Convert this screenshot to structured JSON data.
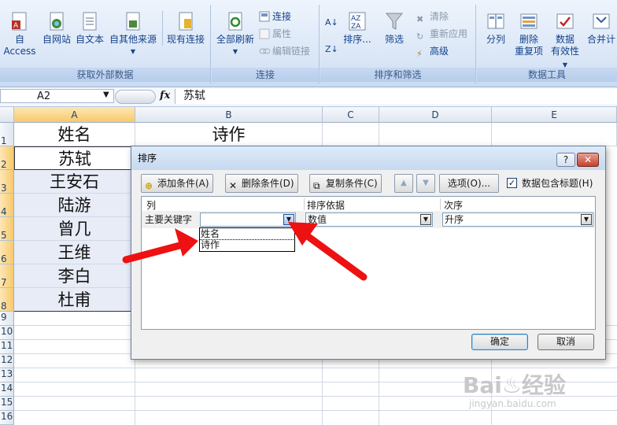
{
  "ribbon": {
    "get_external": {
      "label": "获取外部数据",
      "buttons": [
        "自 Access",
        "自网站",
        "自文本",
        "自其他来源"
      ],
      "existing": "现有连接"
    },
    "connections": {
      "label": "连接",
      "refresh": "全部刷新",
      "items": [
        "连接",
        "属性",
        "编辑链接"
      ]
    },
    "sort_filter": {
      "label": "排序和筛选",
      "sort": "排序...",
      "filter": "筛选",
      "items": [
        "清除",
        "重新应用",
        "高级"
      ]
    },
    "data_tools": {
      "label": "数据工具",
      "split": "分列",
      "remove_dup": [
        "删除",
        "重复项"
      ],
      "validation": [
        "数据",
        "有效性"
      ],
      "consolidate": "合并计"
    }
  },
  "formula_bar": {
    "name_box": "A2",
    "fx": "fx",
    "content": "苏轼"
  },
  "sheet": {
    "columns": [
      "A",
      "B",
      "C",
      "D",
      "E"
    ],
    "rows": [
      "1",
      "2",
      "3",
      "4",
      "5",
      "6",
      "7",
      "8",
      "9",
      "10",
      "11",
      "12",
      "13",
      "14",
      "15",
      "16"
    ],
    "header_row": [
      "姓名",
      "诗作"
    ],
    "names": [
      "苏轼",
      "王安石",
      "陆游",
      "曾几",
      "王维",
      "李白",
      "杜甫"
    ]
  },
  "dialog": {
    "title": "排序",
    "help": "?",
    "close": "✕",
    "toolbar": {
      "add": "添加条件(A)",
      "delete": "删除条件(D)",
      "copy": "复制条件(C)",
      "up": "▲",
      "down": "▼",
      "options": "选项(O)...",
      "has_header_check": "✓",
      "has_header": "数据包含标题(H)"
    },
    "headers": {
      "column": "列",
      "sort_on": "排序依据",
      "order": "次序"
    },
    "row": {
      "label": "主要关键字",
      "key": "",
      "sort_on": "数值",
      "order": "升序"
    },
    "dropdown_options": [
      "姓名",
      "诗作"
    ],
    "ok": "确定",
    "cancel": "取消"
  },
  "watermark": {
    "brand": "Bai♨经验",
    "url": "jingyan.baidu.com"
  },
  "colors": {
    "ribbon_text": "#15428b",
    "arrow": "#ee1111",
    "selected_header": "#f8c96a"
  }
}
